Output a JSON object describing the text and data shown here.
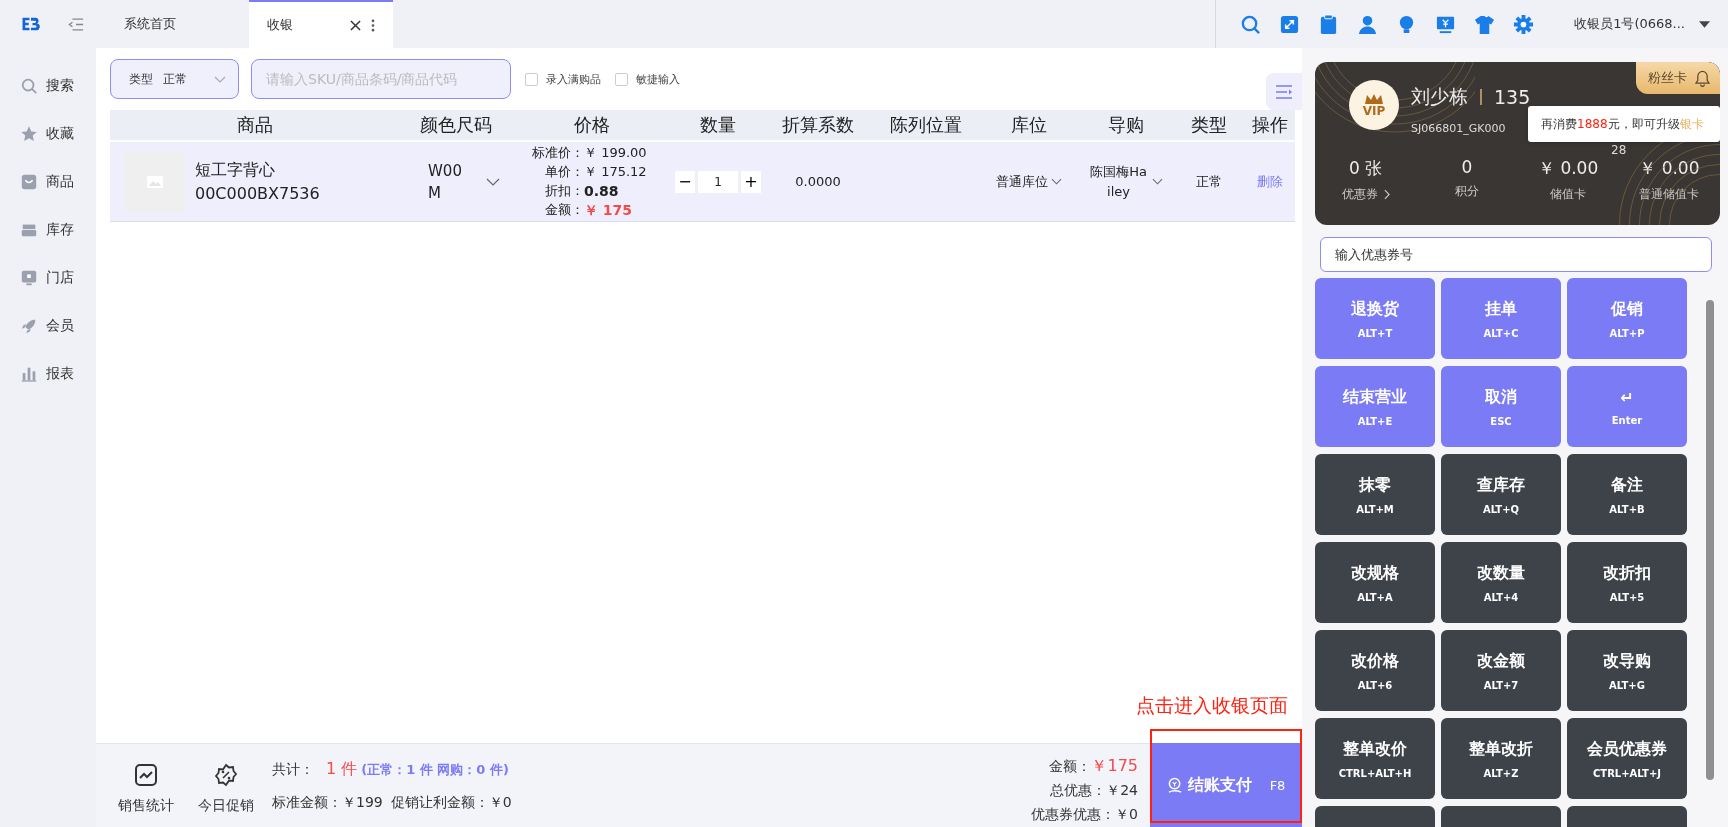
{
  "topbar": {
    "tabs": [
      {
        "label": "系统首页",
        "selected": false
      },
      {
        "label": "收银",
        "selected": true
      }
    ],
    "user": "收银员1号(0668..."
  },
  "sidebar": {
    "items": [
      {
        "label": "搜索"
      },
      {
        "label": "收藏"
      },
      {
        "label": "商品"
      },
      {
        "label": "库存"
      },
      {
        "label": "门店"
      },
      {
        "label": "会员"
      },
      {
        "label": "报表"
      }
    ]
  },
  "toolbar": {
    "type_label": "类型",
    "type_value": "正常",
    "search": {
      "placeholder": "请输入SKU/商品条码/商品代码"
    },
    "checkboxes": [
      {
        "label": "录入满购品",
        "checked": false
      },
      {
        "label": "敏捷输入",
        "checked": false
      }
    ]
  },
  "table": {
    "columns": [
      "商品",
      "颜色尺码",
      "价格",
      "数量",
      "折算系数",
      "陈列位置",
      "库位",
      "导购",
      "类型",
      "操作"
    ],
    "rows": [
      {
        "name": "短工字背心",
        "code": "00C000BX7536",
        "spec": "W00M",
        "prices": [
          {
            "label": "标准价：",
            "value": "￥ 199.00",
            "kind": "plain"
          },
          {
            "label": "单价：",
            "value": "￥ 175.12",
            "kind": "plain"
          },
          {
            "label": "折扣：",
            "value": "0.88",
            "kind": "bold"
          },
          {
            "label": "金额：",
            "value": "￥ 175",
            "kind": "red"
          }
        ],
        "minus": "−",
        "qty": "1",
        "plus": "+",
        "factor": "0.0000",
        "location": "普通库位",
        "guide": "陈国梅Hailey",
        "type": "正常",
        "action": "删除"
      }
    ]
  },
  "footer": {
    "tools": [
      {
        "label": "销售统计"
      },
      {
        "label": "今日促销"
      }
    ],
    "total_label": "共计：",
    "total_count": "1 件",
    "total_detail": "(正常：1 件  网购：0 件)",
    "std_amount": "标准金额：￥199",
    "promo_amount": "促销让利金额：￥0",
    "summary": [
      {
        "label": "金额：",
        "value": "￥175",
        "kind": "red"
      },
      {
        "label": "总优惠：",
        "value": "￥24",
        "kind": "plain"
      },
      {
        "label": "优惠券优惠：",
        "value": "￥0",
        "kind": "plain"
      }
    ],
    "pay": {
      "label": "结账支付",
      "key": "F8"
    },
    "annotation": "点击进入收银页面"
  },
  "member": {
    "badge": "粉丝卡",
    "vip": "VIP",
    "name": "刘少栋",
    "phone": "135",
    "card_no": "SJ066801_GK000",
    "card_no_tail": "28",
    "tooltip": [
      {
        "text": "再消费",
        "kind": "plain"
      },
      {
        "text": "1888",
        "kind": "amount"
      },
      {
        "text": "元，即可升级",
        "kind": "plain"
      },
      {
        "text": "银卡",
        "kind": "level"
      }
    ],
    "stats": [
      {
        "value": "0 张",
        "label": "优惠券",
        "link": true
      },
      {
        "value": "0",
        "label": "积分",
        "link": false
      },
      {
        "value": "￥ 0.00",
        "label": "储值卡",
        "link": false
      },
      {
        "value": "￥ 0.00",
        "label": "普通储值卡",
        "link": false
      }
    ],
    "coupon": {
      "placeholder": "输入优惠券号"
    }
  },
  "keys": [
    {
      "label": "退换货",
      "key": "ALT+T",
      "kind": "primary"
    },
    {
      "label": "挂单",
      "key": "ALT+C",
      "kind": "primary"
    },
    {
      "label": "促销",
      "key": "ALT+P",
      "kind": "primary"
    },
    {
      "label": "结束营业",
      "key": "ALT+E",
      "kind": "primary"
    },
    {
      "label": "取消",
      "key": "ESC",
      "kind": "primary"
    },
    {
      "label": "↵",
      "key": "Enter",
      "kind": "primary"
    },
    {
      "label": "抹零",
      "key": "ALT+M",
      "kind": "dark"
    },
    {
      "label": "查库存",
      "key": "ALT+Q",
      "kind": "dark"
    },
    {
      "label": "备注",
      "key": "ALT+B",
      "kind": "dark"
    },
    {
      "label": "改规格",
      "key": "ALT+A",
      "kind": "dark"
    },
    {
      "label": "改数量",
      "key": "ALT+4",
      "kind": "dark"
    },
    {
      "label": "改折扣",
      "key": "ALT+5",
      "kind": "dark"
    },
    {
      "label": "改价格",
      "key": "ALT+6",
      "kind": "dark"
    },
    {
      "label": "改金额",
      "key": "ALT+7",
      "kind": "dark"
    },
    {
      "label": "改导购",
      "key": "ALT+G",
      "kind": "dark"
    },
    {
      "label": "整单改价",
      "key": "CTRL+ALT+H",
      "kind": "dark"
    },
    {
      "label": "整单改折",
      "key": "ALT+Z",
      "kind": "dark"
    },
    {
      "label": "会员优惠券",
      "key": "CTRL+ALT+J",
      "kind": "dark"
    },
    {
      "kind": "dark"
    },
    {
      "kind": "dark"
    },
    {
      "kind": "dark"
    }
  ]
}
